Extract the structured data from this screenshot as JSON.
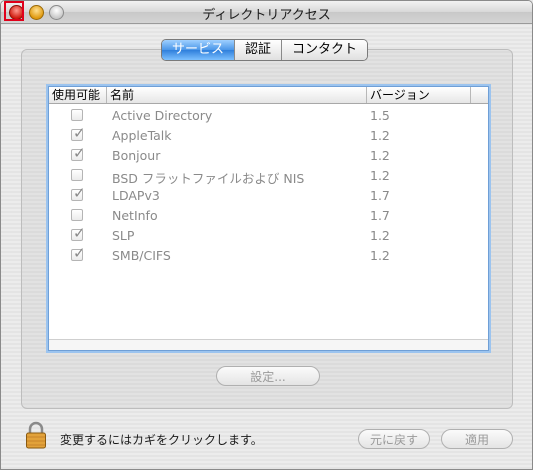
{
  "window": {
    "title": "ディレクトリアクセス"
  },
  "tabs": [
    {
      "label": "サービス",
      "active": true
    },
    {
      "label": "認証",
      "active": false
    },
    {
      "label": "コンタクト",
      "active": false
    }
  ],
  "table": {
    "headers": {
      "enabled": "使用可能",
      "name": "名前",
      "version": "バージョン"
    },
    "rows": [
      {
        "enabled": false,
        "name": "Active Directory",
        "version": "1.5"
      },
      {
        "enabled": true,
        "name": "AppleTalk",
        "version": "1.2"
      },
      {
        "enabled": true,
        "name": "Bonjour",
        "version": "1.2"
      },
      {
        "enabled": false,
        "name": "BSD フラットファイルおよび NIS",
        "version": "1.2"
      },
      {
        "enabled": true,
        "name": "LDAPv3",
        "version": "1.7"
      },
      {
        "enabled": false,
        "name": "NetInfo",
        "version": "1.7"
      },
      {
        "enabled": true,
        "name": "SLP",
        "version": "1.2"
      },
      {
        "enabled": true,
        "name": "SMB/CIFS",
        "version": "1.2"
      }
    ]
  },
  "buttons": {
    "settings": "設定...",
    "revert": "元に戻す",
    "apply": "適用"
  },
  "lock": {
    "text": "変更するにはカギをクリックします。",
    "icon": "lock-icon"
  },
  "colors": {
    "accent": "#4a96e8",
    "close_highlight": "#e0001a"
  }
}
